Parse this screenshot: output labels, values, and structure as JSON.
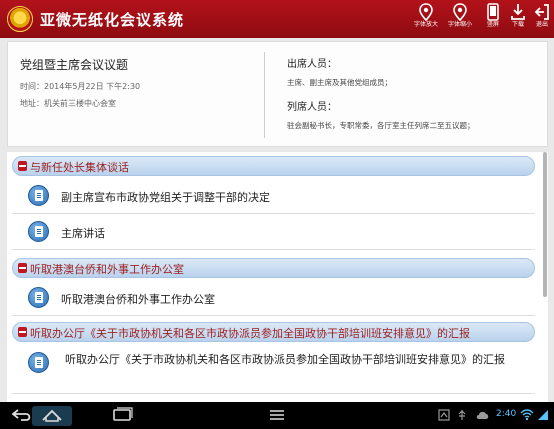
{
  "app": {
    "title": "亚微无纸化会议系统"
  },
  "toolbar": [
    {
      "name": "font-larger",
      "label": "字体放大",
      "icon": "map-pin-icon"
    },
    {
      "name": "font-smaller",
      "label": "字体缩小",
      "icon": "map-pin-icon"
    },
    {
      "name": "landscape",
      "label": "竖屏",
      "icon": "phone-icon"
    },
    {
      "name": "download",
      "label": "下载",
      "icon": "download-icon"
    },
    {
      "name": "exit",
      "label": "退出",
      "icon": "exit-icon"
    }
  ],
  "meeting": {
    "title": "党组暨主席会议议题",
    "time": "时间：2014年5月22日    下午2:30",
    "address": "地址：机关前三楼中心会室",
    "attendees_label": "出席人员：",
    "attendees": "主席、副主席及其他党组成员；",
    "observers_label": "列席人员：",
    "observers": "驻会副秘书长，专职常委，各厅室主任列席二至五议题；"
  },
  "agenda": [
    {
      "section": "与新任处长集体谈话",
      "items": [
        "副主席宣布市政协党组关于调整干部的决定",
        "主席讲话"
      ]
    },
    {
      "section": "听取港澳台侨和外事工作办公室",
      "items": [
        "听取港澳台侨和外事工作办公室"
      ]
    },
    {
      "section": "听取办公厅《关于市政协机关和各区市政协派员参加全国政协干部培训班安排意见》的汇报",
      "items": [
        "听取办公厅《关于市政协机关和各区市政协派员参加全国政协干部培训班安排意见》的汇报"
      ]
    }
  ],
  "status_bar": {
    "time": "2:40"
  },
  "colors": {
    "header": "#a8121a",
    "section_text": "#9e2121",
    "section_bg": "#c9ddf1",
    "status_time": "#59c2ff"
  }
}
